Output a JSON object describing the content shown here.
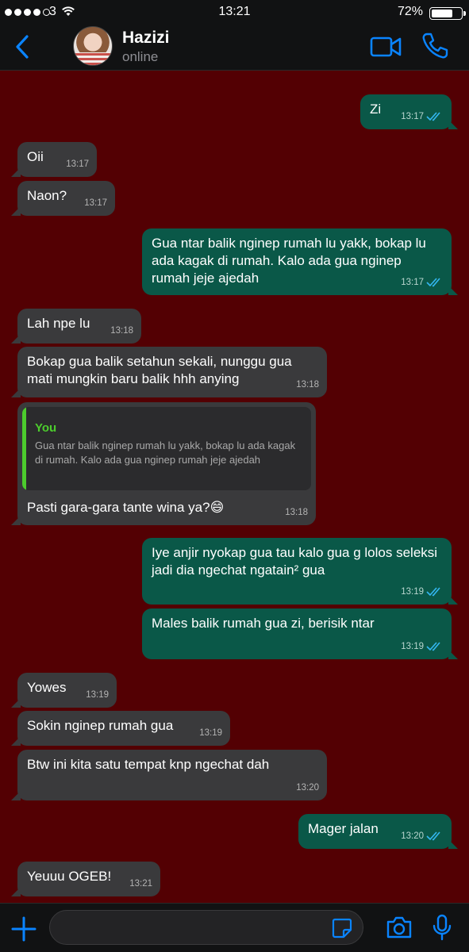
{
  "status_bar": {
    "carrier": "3",
    "time": "13:21",
    "battery": "72%"
  },
  "header": {
    "name": "Hazizi",
    "status": "online"
  },
  "colors": {
    "accent": "#0a84ff",
    "background": "#530003",
    "incoming": "#3a3a3c",
    "outgoing": "#0a5848",
    "quote_accent": "#4ccd2d"
  },
  "messages": [
    {
      "dir": "out",
      "text": "Zi",
      "time": "13:17",
      "read": true
    },
    {
      "dir": "in",
      "text": "Oii",
      "time": "13:17"
    },
    {
      "dir": "in",
      "text": "Naon?",
      "time": "13:17"
    },
    {
      "dir": "out",
      "text": "Gua ntar balik nginep rumah lu yakk, bokap lu ada kagak di rumah. Kalo ada gua nginep rumah jeje ajedah",
      "time": "13:17",
      "read": true
    },
    {
      "dir": "in",
      "text": "Lah npe lu",
      "time": "13:18"
    },
    {
      "dir": "in",
      "text": "Bokap gua balik setahun sekali, nunggu gua mati mungkin baru balik hhh anying",
      "time": "13:18"
    },
    {
      "dir": "in",
      "text": "Pasti gara-gara tante wina ya?😄",
      "time": "13:18",
      "quote": {
        "author": "You",
        "text": "Gua ntar balik nginep rumah lu yakk, bokap lu ada kagak di rumah. Kalo ada gua nginep rumah jeje ajedah"
      }
    },
    {
      "dir": "out",
      "text": "Iye anjir nyokap gua tau kalo gua g lolos seleksi jadi dia ngechat ngatain² gua",
      "time": "13:19",
      "read": true
    },
    {
      "dir": "out",
      "text": "Males balik rumah gua zi, berisik ntar",
      "time": "13:19",
      "read": true
    },
    {
      "dir": "in",
      "text": "Yowes",
      "time": "13:19"
    },
    {
      "dir": "in",
      "text": "Sokin nginep rumah gua",
      "time": "13:19"
    },
    {
      "dir": "in",
      "text": "Btw ini kita satu tempat knp ngechat dah",
      "time": "13:20"
    },
    {
      "dir": "out",
      "text": "Mager jalan",
      "time": "13:20",
      "read": true
    },
    {
      "dir": "in",
      "text": "Yeuuu OGEB!",
      "time": "13:21"
    }
  ],
  "composer": {
    "value": "",
    "placeholder": ""
  },
  "icons": [
    "back-icon",
    "video-call-icon",
    "phone-icon",
    "plus-icon",
    "sticker-icon",
    "camera-icon",
    "microphone-icon",
    "double-tick-icon"
  ]
}
